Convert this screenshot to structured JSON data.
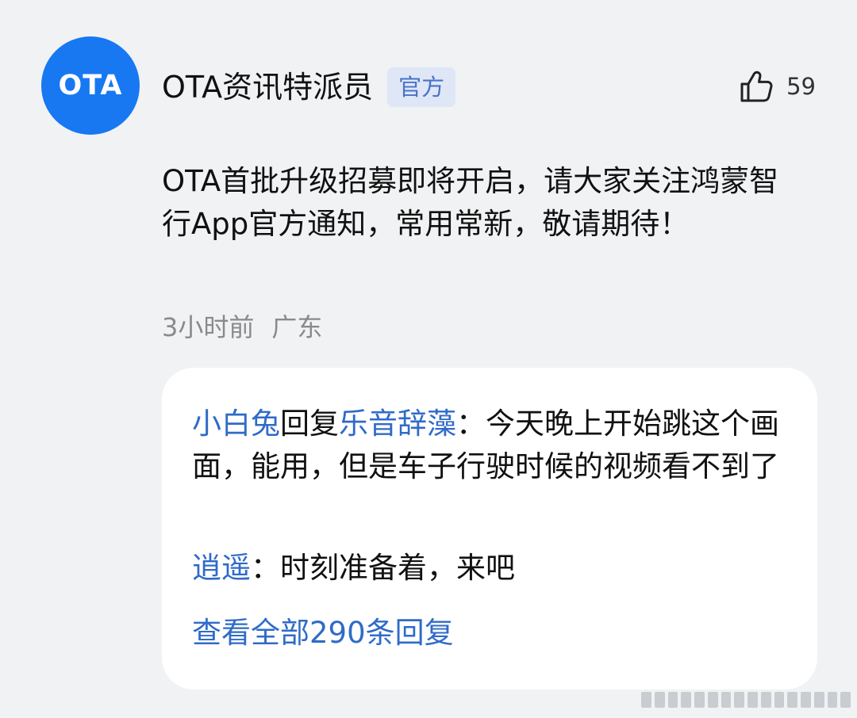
{
  "post": {
    "author": {
      "avatar_text": "OTA",
      "name": "OTA资讯特派员",
      "badge": "官方"
    },
    "likes": {
      "icon": "thumb-up-icon",
      "count": "59"
    },
    "content": "OTA首批升级招募即将开启，请大家关注鸿蒙智行App官方通知，常用常新，敬请期待！",
    "meta": {
      "time": "3小时前",
      "location": "广东"
    }
  },
  "replies": [
    {
      "from": "小白兔",
      "verb": "回复",
      "to": "乐音辞藻",
      "separator": "：",
      "text": "今天晚上开始跳这个画面，能用，但是车子行驶时候的视频看不到了"
    },
    {
      "from": "逍遥",
      "separator": "：",
      "text": "时刻准备着，来吧"
    }
  ],
  "view_all": "查看全部290条回复",
  "colors": {
    "background": "#f1f2f4",
    "avatar_blue": "#1778f2",
    "link_blue": "#2f6bc8",
    "badge_bg": "#dfe7f7",
    "badge_text": "#4b73c9",
    "meta_gray": "#8a8a8a"
  }
}
